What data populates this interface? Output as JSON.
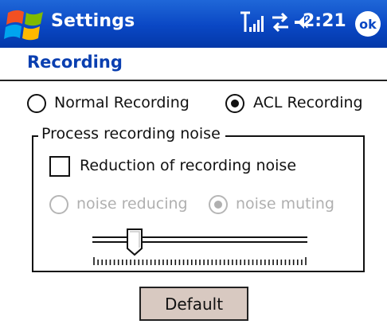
{
  "titlebar": {
    "app_title": "Settings",
    "time": "2:21",
    "ok_label": "ok",
    "icons": [
      "windows-start-icon",
      "signal-icon",
      "connectivity-icon",
      "volume-icon"
    ],
    "color": "#0a47c4"
  },
  "page": {
    "title": "Recording",
    "title_color": "#0a3fb0"
  },
  "recording_mode": {
    "options": [
      {
        "label": "Normal Recording",
        "selected": false
      },
      {
        "label": "ACL Recording",
        "selected": true
      }
    ]
  },
  "noise_group": {
    "legend": "Process recording noise",
    "reduction_checkbox": {
      "label": "Reduction of recording noise",
      "checked": false
    },
    "noise_options": [
      {
        "label": "noise reducing",
        "selected": false,
        "enabled": false
      },
      {
        "label": "noise muting",
        "selected": true,
        "enabled": false
      }
    ],
    "slider": {
      "value": 0.17
    }
  },
  "actions": {
    "default_label": "Default",
    "default_color": "#d8c9c1"
  }
}
